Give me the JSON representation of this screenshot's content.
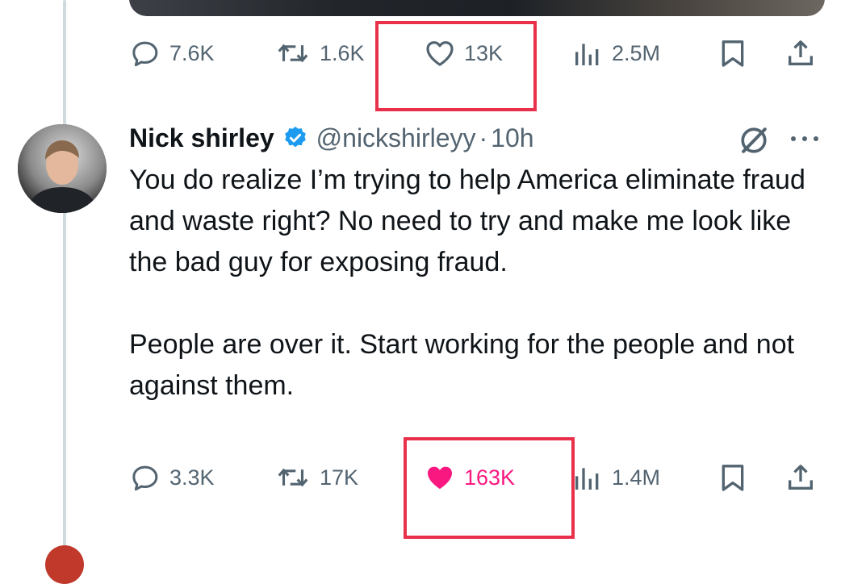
{
  "previous_tweet": {
    "actions": {
      "replies": "7.6K",
      "reposts": "1.6K",
      "likes": "13K",
      "views": "2.5M"
    }
  },
  "tweet": {
    "author_name": "Nick shirley",
    "handle": "@nickshirleyy",
    "separator": "·",
    "time": "10h",
    "text_p1": "You do realize I’m trying to help America eliminate fraud and waste right? No need to try and make me look like the bad guy for exposing fraud.",
    "text_p2": "People are over it. Start working for the people and not against them.",
    "actions": {
      "replies": "3.3K",
      "reposts": "17K",
      "likes": "163K",
      "liked": true,
      "views": "1.4M"
    }
  },
  "icons": {
    "reply": "speech-bubble-icon",
    "repost": "repost-arrows-icon",
    "like": "heart-icon",
    "views": "bar-chart-icon",
    "bookmark": "bookmark-icon",
    "share": "share-upload-icon",
    "verified": "verified-badge-icon",
    "grok": "grok-slash-circle-icon",
    "more": "more-dots-icon"
  },
  "colors": {
    "text_primary": "#0f1419",
    "text_secondary": "#536471",
    "like_active": "#f91880",
    "verified_blue": "#1d9bf0",
    "highlight_box": "#e8304a",
    "thread_line": "#cfd9de"
  }
}
